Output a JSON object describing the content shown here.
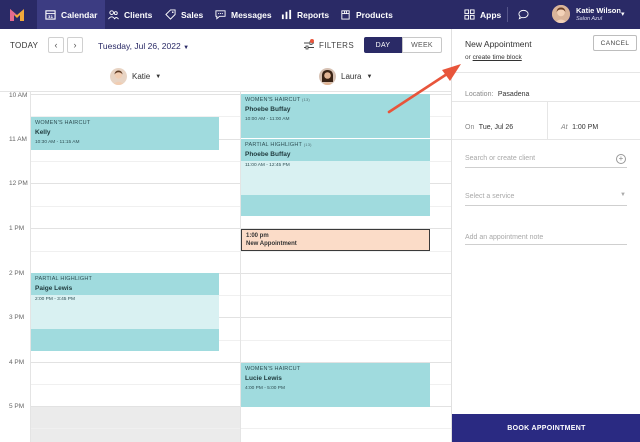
{
  "nav": {
    "items": [
      {
        "label": "Calendar",
        "icon": "calendar-icon"
      },
      {
        "label": "Clients",
        "icon": "users-icon"
      },
      {
        "label": "Sales",
        "icon": "tag-icon"
      },
      {
        "label": "Messages",
        "icon": "chat-icon"
      },
      {
        "label": "Reports",
        "icon": "bar-chart-icon"
      },
      {
        "label": "Products",
        "icon": "box-icon"
      }
    ],
    "apps_label": "Apps",
    "user_name": "Katie Wilson",
    "user_salon": "Salon Azul"
  },
  "toolbar": {
    "today_label": "TODAY",
    "prev_label": "‹",
    "next_label": "›",
    "date_label": "Tuesday, Jul 26, 2022",
    "filters_label": "FILTERS",
    "day_label": "DAY",
    "week_label": "WEEK"
  },
  "staff": [
    {
      "name": "Katie"
    },
    {
      "name": "Laura"
    }
  ],
  "hours": [
    "10 AM",
    "11 AM",
    "12 PM",
    "1 PM",
    "2 PM",
    "3 PM",
    "4 PM",
    "5 PM"
  ],
  "appointments": {
    "kelly": {
      "service": "WOMEN'S HAIRCUT",
      "client": "Kelly",
      "time": "10:30 AM - 11:15 AM"
    },
    "paige": {
      "service": "PARTIAL HIGHLIGHT",
      "client": "Paige Lewis",
      "time": "2:00 PM - 3:45 PM"
    },
    "phoebe_cut": {
      "service": "WOMEN'S HAIRCUT",
      "badge": "(13)",
      "client": "Phoebe Buffay",
      "time": "10:00 AM - 11:00 AM"
    },
    "phoebe_hl": {
      "service": "PARTIAL HIGHLIGHT",
      "badge": "(13)",
      "client": "Phoebe Buffay",
      "time": "11:00 AM - 12:45 PM"
    },
    "lucie": {
      "service": "WOMEN'S HAIRCUT",
      "client": "Lucie Lewis",
      "time": "4:00 PM - 5:00 PM"
    }
  },
  "new_appointment_block": {
    "time": "1:00 pm",
    "label": "New Appointment"
  },
  "panel": {
    "title": "New Appointment",
    "or_text": "or",
    "create_block_link": "create time block",
    "cancel_label": "CANCEL",
    "location_label": "Location:",
    "location_value": "Pasadena",
    "on_label": "On",
    "on_value": "Tue, Jul 26",
    "at_label": "At",
    "at_value": "1:00 PM",
    "client_placeholder": "Search or create client",
    "service_placeholder": "Select a service",
    "note_placeholder": "Add an appointment note",
    "book_label": "BOOK APPOINTMENT"
  },
  "colors": {
    "nav_bg": "#2a2a66",
    "appointment": "#a0dbde",
    "processing": "#d9f1f2",
    "new_appointment": "#fbdcc8",
    "book_button": "#2a2a82",
    "annotation_arrow": "#e8553b"
  }
}
